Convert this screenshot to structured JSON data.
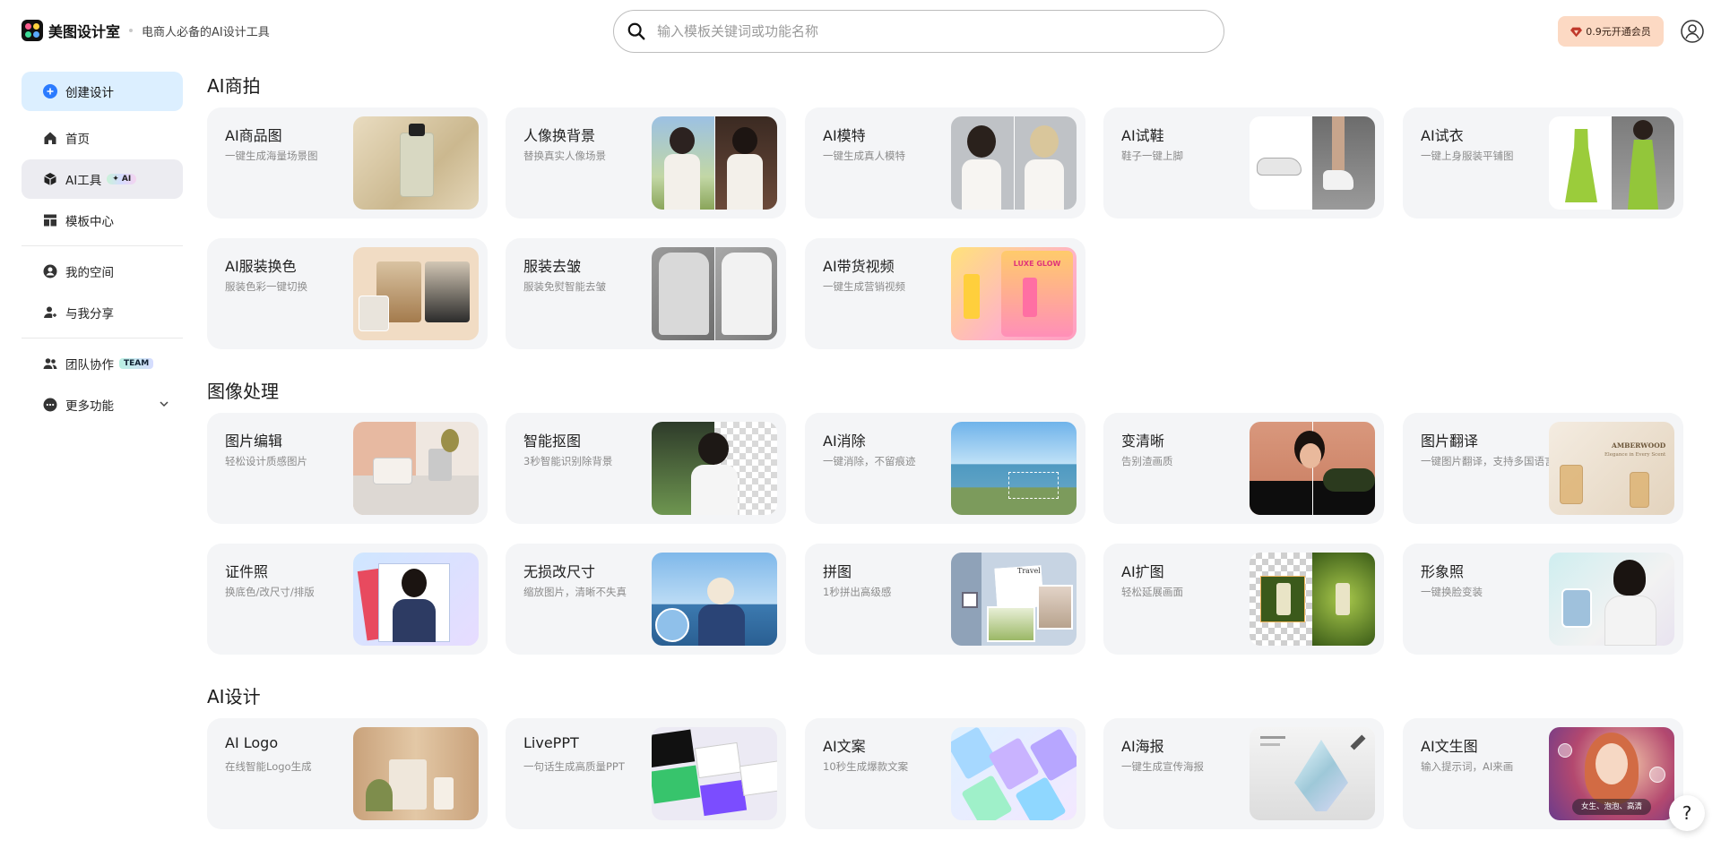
{
  "header": {
    "logo_name": "美图设计室",
    "slogan": "电商人必备的AI设计工具",
    "search_placeholder": "输入模板关键词或功能名称",
    "vip_label": "0.9元开通会员"
  },
  "sidebar": {
    "create": "创建设计",
    "home": "首页",
    "ai_tools": "AI工具",
    "ai_badge": "✦ AI",
    "templates": "模板中心",
    "my_space": "我的空间",
    "shared": "与我分享",
    "team": "团队协作",
    "team_badge": "TEAM",
    "more": "更多功能"
  },
  "sections": {
    "ai_shoot": "AI商拍",
    "image_processing": "图像处理",
    "ai_design": "AI设计"
  },
  "cards": {
    "product_photo": {
      "title": "AI商品图",
      "desc": "一键生成海量场景图"
    },
    "portrait_bg": {
      "title": "人像换背景",
      "desc": "替换真实人像场景"
    },
    "ai_model": {
      "title": "AI模特",
      "desc": "一键生成真人模特"
    },
    "shoe_try": {
      "title": "AI试鞋",
      "desc": "鞋子一键上脚"
    },
    "cloth_try": {
      "title": "AI试衣",
      "desc": "一键上身服装平铺图"
    },
    "cloth_color": {
      "title": "AI服装换色",
      "desc": "服装色彩一键切换"
    },
    "wrinkle": {
      "title": "服装去皱",
      "desc": "服装免熨智能去皱"
    },
    "video": {
      "title": "AI带货视频",
      "desc": "一键生成营销视频"
    },
    "edit": {
      "title": "图片编辑",
      "desc": "轻松设计质感图片"
    },
    "cutout": {
      "title": "智能抠图",
      "desc": "3秒智能识别除背景"
    },
    "erase": {
      "title": "AI消除",
      "desc": "一键消除，不留痕迹"
    },
    "sharpen": {
      "title": "变清晰",
      "desc": "告别渣画质"
    },
    "translate": {
      "title": "图片翻译",
      "desc": "一键图片翻译，支持多国语言"
    },
    "id_photo": {
      "title": "证件照",
      "desc": "换底色/改尺寸/排版"
    },
    "resize": {
      "title": "无损改尺寸",
      "desc": "缩放图片，清晰不失真"
    },
    "collage": {
      "title": "拼图",
      "desc": "1秒拼出高级感"
    },
    "expand": {
      "title": "AI扩图",
      "desc": "轻松延展画面"
    },
    "avatar": {
      "title": "形象照",
      "desc": "一键换脸变装"
    },
    "logo": {
      "title": "AI Logo",
      "desc": "在线智能Logo生成"
    },
    "ppt": {
      "title": "LivePPT",
      "desc": "一句话生成高质量PPT"
    },
    "copy": {
      "title": "AI文案",
      "desc": "10秒生成爆款文案"
    },
    "poster": {
      "title": "AI海报",
      "desc": "一键生成宣传海报"
    },
    "text2img": {
      "title": "AI文生图",
      "desc": "输入提示词，AI来画"
    }
  },
  "thumb_text": {
    "video_banner": "LUXE GLOW",
    "translate_brand": "AMBERWOOD",
    "translate_sub": "Elegance in Every Scent",
    "collage_note": "Travel",
    "text2img_tags": "女生、泡泡、高清"
  },
  "help_label": "?",
  "colors": {
    "accent_create": "#dcefff",
    "active_item": "#ececf1",
    "vip_bg": "#fcd9c3",
    "card_bg": "#f4f5f7"
  }
}
